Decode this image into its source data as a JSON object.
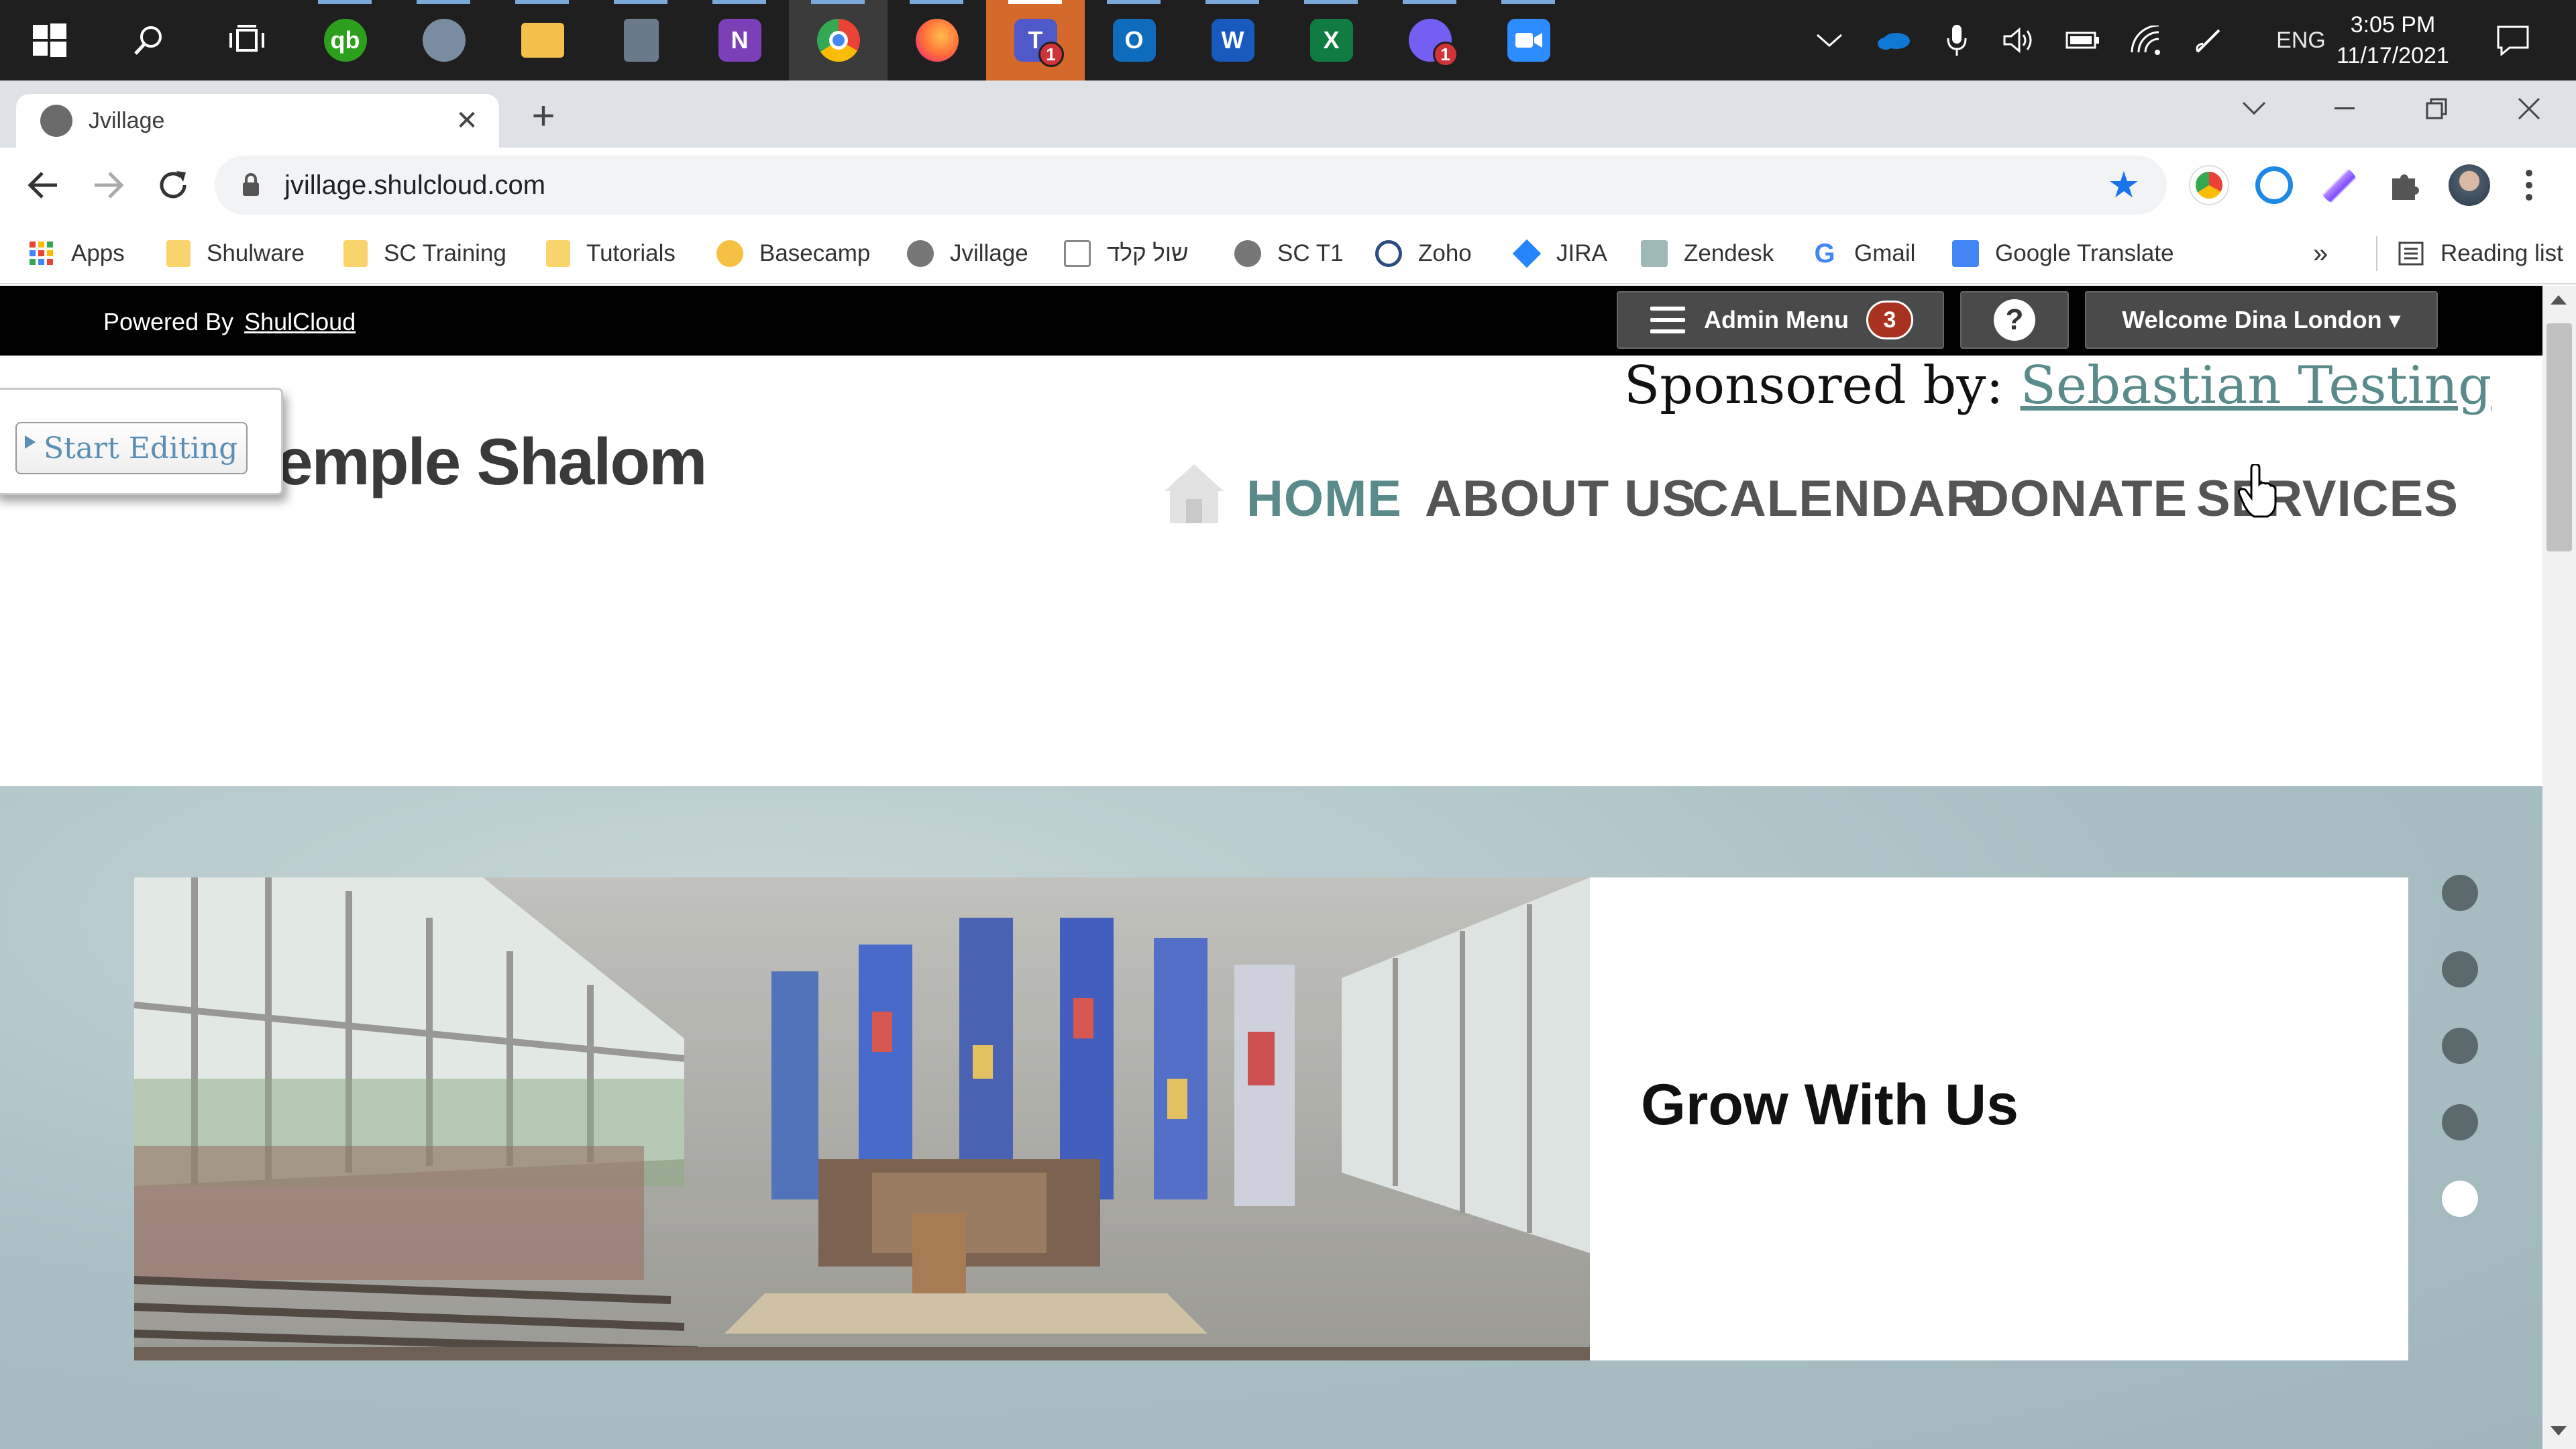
{
  "taskbar": {
    "apps": [
      {
        "name": "QuickBooks",
        "letter": "qb",
        "color": "#2ca01c"
      },
      {
        "name": "Photos",
        "letter": "",
        "color": "#7a8da0"
      },
      {
        "name": "File Explorer",
        "letter": "",
        "color": "#f2c04b"
      },
      {
        "name": "Calculator",
        "letter": "",
        "color": "#6b7a8a"
      },
      {
        "name": "OneNote",
        "letter": "N",
        "color": "#7b3fb7"
      },
      {
        "name": "Chrome",
        "letter": "",
        "color": "#4285f4"
      },
      {
        "name": "Firefox",
        "letter": "",
        "color": "#ff7139"
      },
      {
        "name": "Teams",
        "letter": "T",
        "color": "#5059c9",
        "badge": "1"
      },
      {
        "name": "Outlook",
        "letter": "O",
        "color": "#0f6cbd"
      },
      {
        "name": "Word",
        "letter": "W",
        "color": "#185abd"
      },
      {
        "name": "Excel",
        "letter": "X",
        "color": "#107c41"
      },
      {
        "name": "Viber",
        "letter": "",
        "color": "#7360f2",
        "badge": "1"
      },
      {
        "name": "Zoom",
        "letter": "",
        "color": "#2d8cff"
      }
    ],
    "language": "ENG",
    "time": "3:05 PM",
    "date": "11/17/2021"
  },
  "browser": {
    "tab_title": "Jvillage",
    "url": "jvillage.shulcloud.com",
    "bookmarks": [
      "Apps",
      "Shulware",
      "SC Training",
      "Tutorials",
      "Basecamp",
      "Jvillage",
      "שול קלד",
      "SC T1",
      "Zoho",
      "JIRA",
      "Zendesk",
      "Gmail",
      "Google Translate"
    ],
    "reading_list": "Reading list",
    "overflow": "»"
  },
  "admin": {
    "powered_by": "Powered By",
    "powered_link": "ShulCloud",
    "admin_menu": "Admin Menu",
    "admin_count": "3",
    "help": "?",
    "welcome": "Welcome Dina London ▾"
  },
  "site": {
    "sponsored_label": "Sponsored by:",
    "sponsor_name": "Sebastian Testing",
    "logo_text": "emple Shalom",
    "start_editing": "Start Editing",
    "menu": [
      "HOME",
      "ABOUT US",
      "CALENDAR",
      "DONATE",
      "SERVICES"
    ],
    "active_menu": "HOME"
  },
  "hero": {
    "slide_title": "Grow With Us",
    "slide_count": 5,
    "active_slide": 5
  },
  "colors": {
    "accent": "#5a8a8a",
    "admin_bar": "#000000",
    "hero_bg": "#a9bfc3",
    "badge": "#a8321f"
  }
}
